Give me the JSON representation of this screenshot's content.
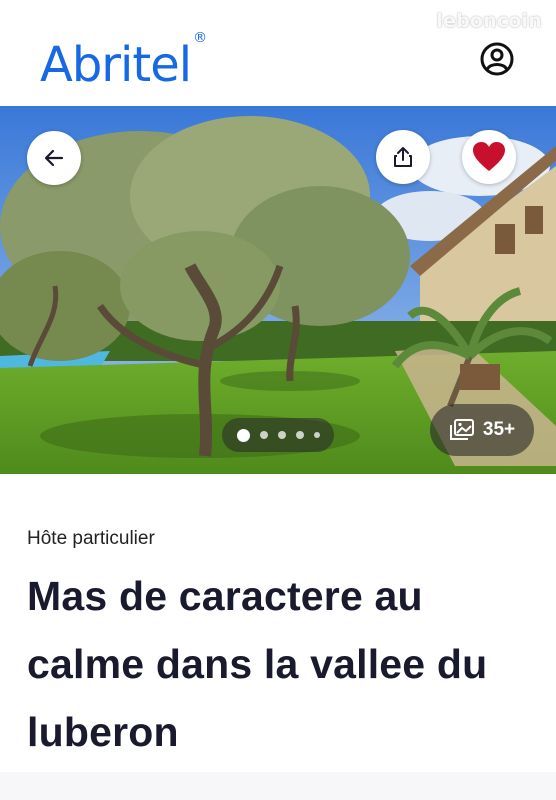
{
  "header": {
    "logo_text": "Abritel",
    "logo_mark": "®",
    "watermark": "leboncoin",
    "account_icon": "account-circle-icon"
  },
  "hero": {
    "back_icon": "arrow-left-icon",
    "share_icon": "share-icon",
    "favorite_icon": "heart-icon",
    "favorite_color": "#c8102e",
    "carousel_dots": 5,
    "carousel_active": 0,
    "photo_count_label": "35+",
    "photo_count_icon": "photo-gallery-icon"
  },
  "listing": {
    "host_type": "Hôte particulier",
    "title": "Mas de caractere au calme dans la vallee du luberon"
  },
  "colors": {
    "brand": "#1668e3",
    "title": "#1a1a2e"
  }
}
